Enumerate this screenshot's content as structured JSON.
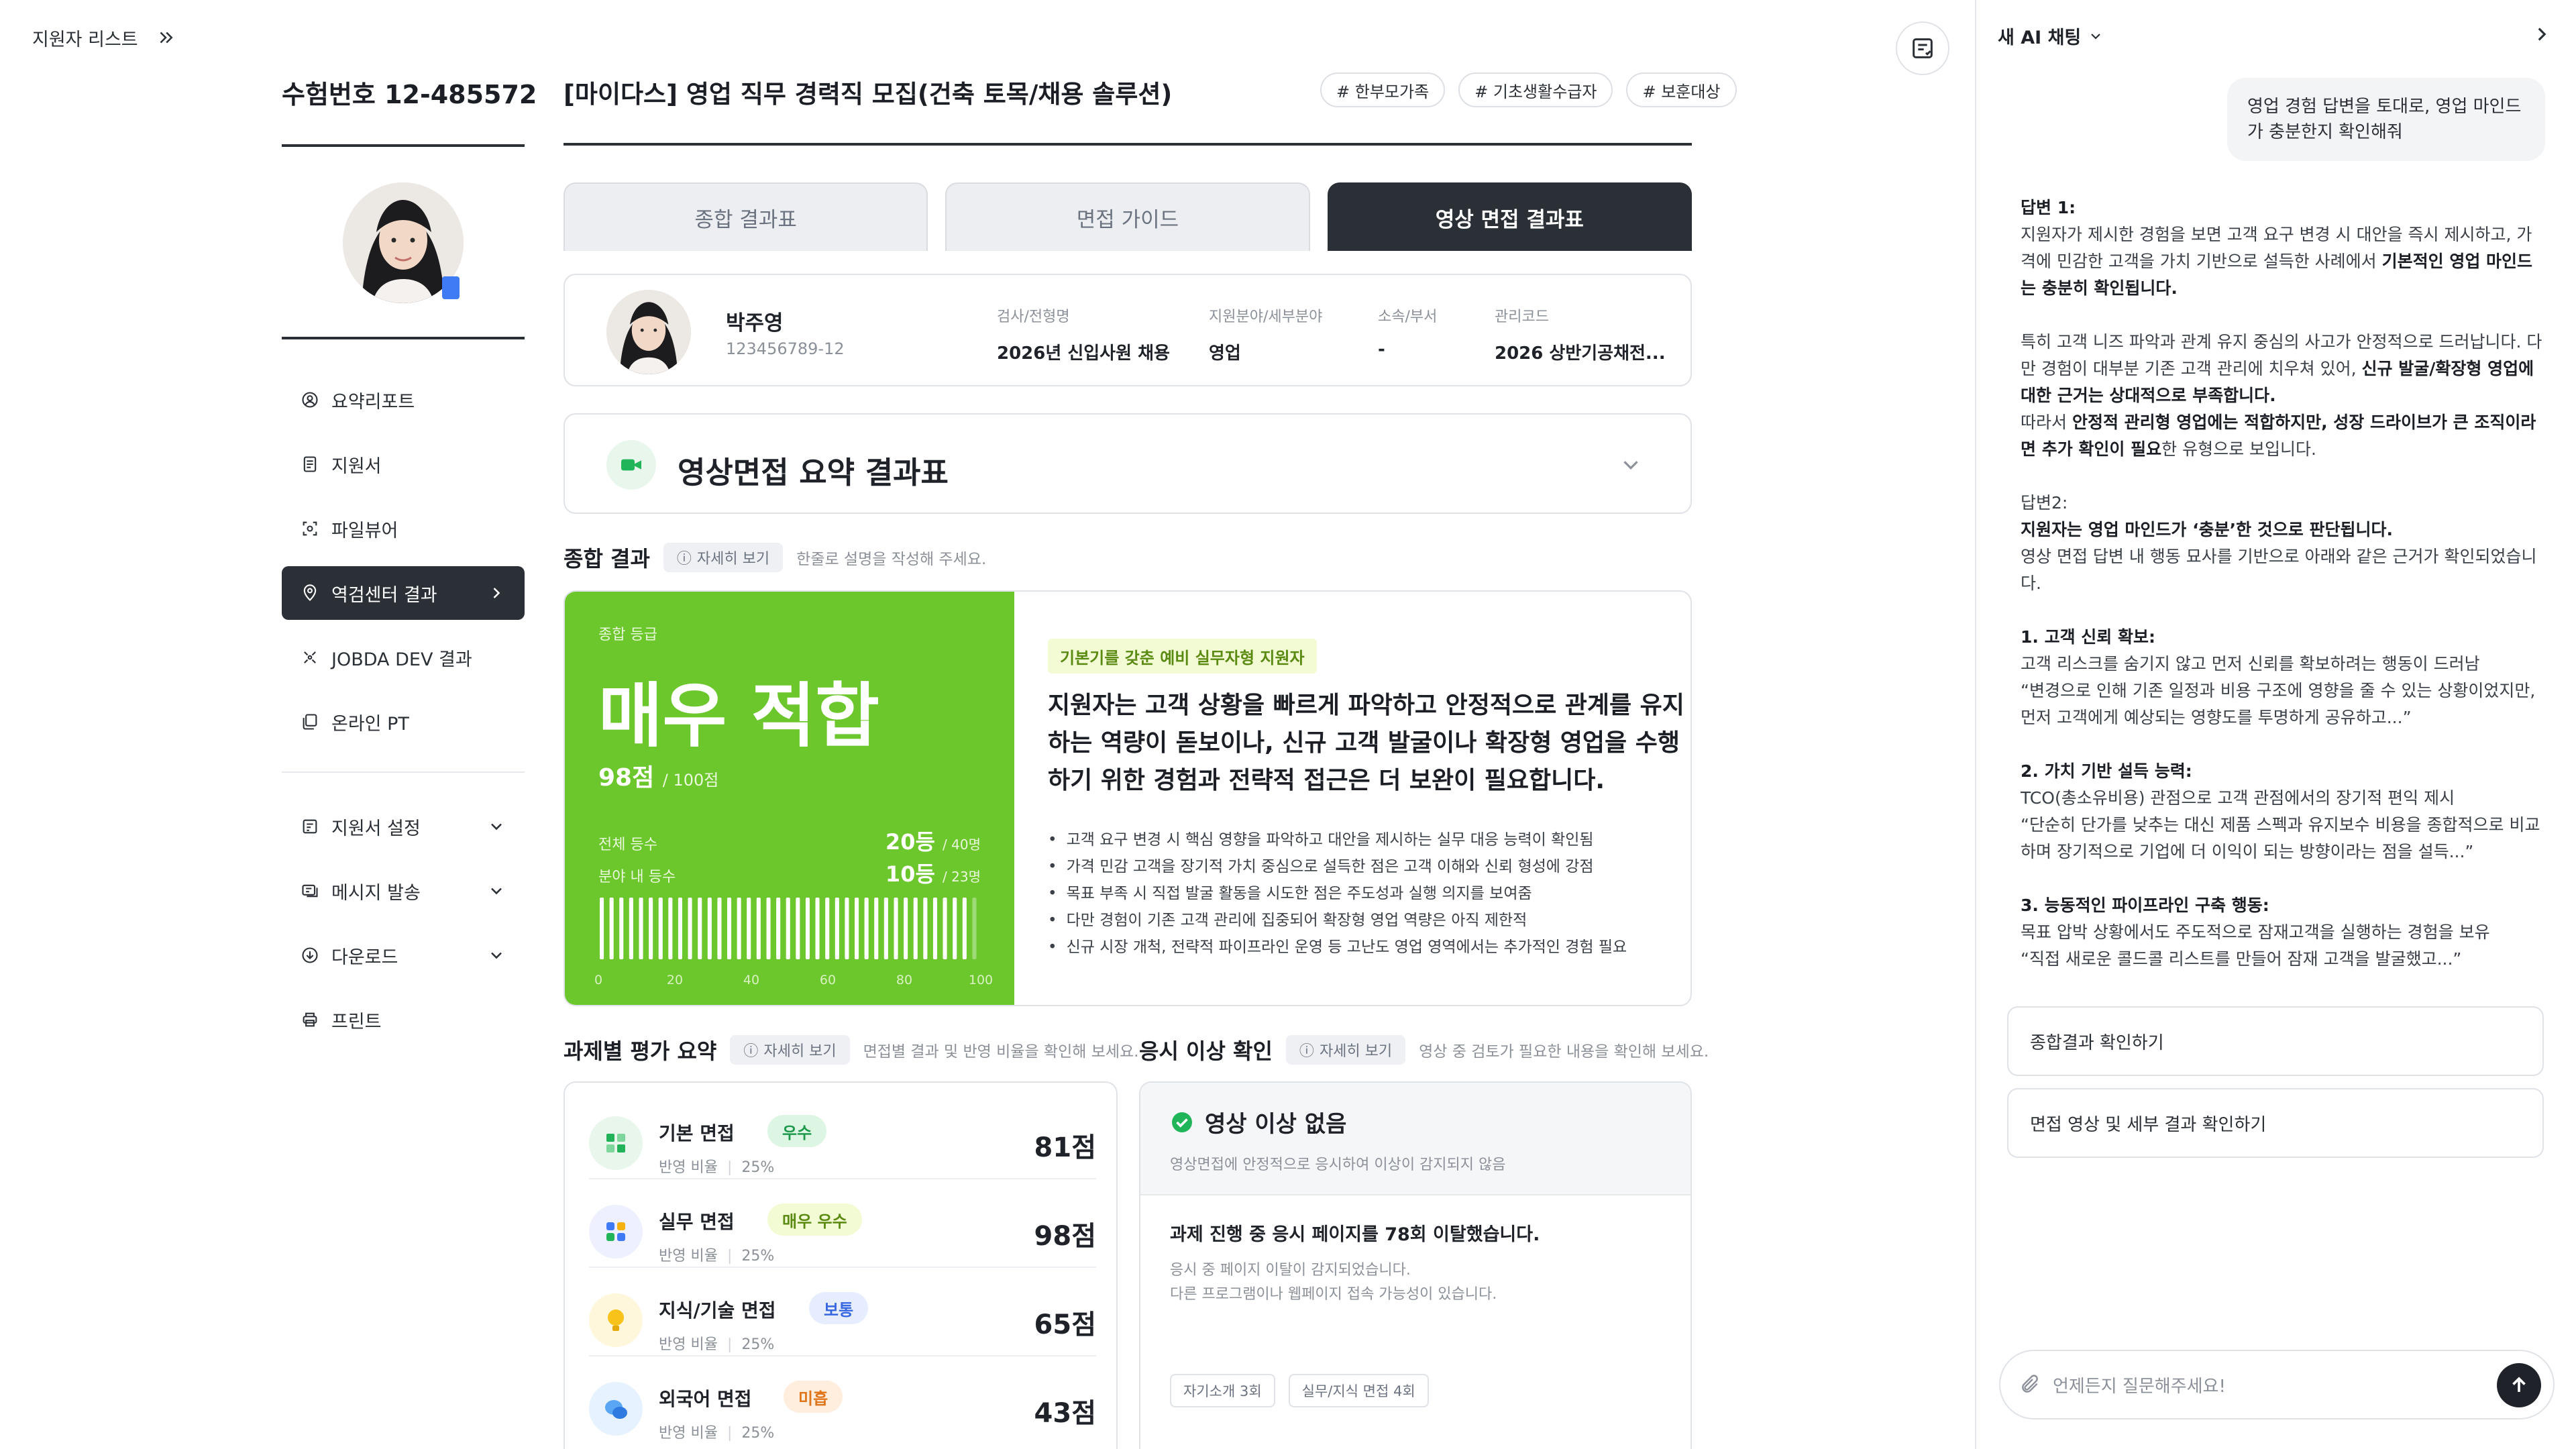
{
  "topnav": {
    "label": "지원자 리스트"
  },
  "exam": "수험번호 12-485572",
  "job_title": "[마이다스] 영업 직무 경력직 모집(건축 토목/채용 솔루션)",
  "tags": [
    "# 한부모가족",
    "# 기초생활수급자",
    "# 보훈대상"
  ],
  "sidebar": {
    "items": [
      {
        "label": "요약리포트",
        "icon": "user-circle-icon"
      },
      {
        "label": "지원서",
        "icon": "document-icon"
      },
      {
        "label": "파일뷰어",
        "icon": "scan-icon"
      },
      {
        "label": "역검센터 결과",
        "icon": "location-icon",
        "active": true
      },
      {
        "label": "JOBDA DEV 결과",
        "icon": "code-icon"
      },
      {
        "label": "온라인 PT",
        "icon": "slides-icon"
      }
    ],
    "items2": [
      {
        "label": "지원서 설정",
        "icon": "form-settings-icon"
      },
      {
        "label": "메시지 발송",
        "icon": "message-icon"
      },
      {
        "label": "다운로드",
        "icon": "download-icon"
      },
      {
        "label": "프린트",
        "icon": "printer-icon"
      }
    ]
  },
  "tabs": [
    "종합 결과표",
    "면접 가이드",
    "영상 면접 결과표"
  ],
  "profile": {
    "name": "박주영",
    "id": "123456789-12",
    "cols": [
      {
        "label": "검사/전형명",
        "value": "2026년 신입사원 채용"
      },
      {
        "label": "지원분야/세부분야",
        "value": "영업"
      },
      {
        "label": "소속/부서",
        "value": "-"
      },
      {
        "label": "관리코드",
        "value": "2026 상반기공채전..."
      }
    ]
  },
  "summary_title": "영상면접 요약 결과표",
  "overall": {
    "title": "종합 결과",
    "detail": "자세히 보기",
    "hint": "한줄로 설명을 작성해 주세요.",
    "grade_label": "종합 등급",
    "grade": "매우 적합",
    "score": "98점",
    "score_total": "/ 100점",
    "rank_all_label": "전체 등수",
    "rank_all": "20등",
    "rank_all_total": "/ 40명",
    "rank_field_label": "분야 내 등수",
    "rank_field": "10등",
    "rank_field_total": "/ 23명",
    "axis": [
      "0",
      "20",
      "40",
      "60",
      "80",
      "100"
    ],
    "badge": "기본기를 갖춘 예비 실무자형 지원자",
    "verdict": "지원자는 고객 상황을 빠르게 파악하고 안정적으로 관계를 유지하는 역량이 돋보이나, 신규 고객 발굴이나 확장형 영업을 수행하기 위한 경험과 전략적 접근은 더 보완이 필요합니다.",
    "bullets": [
      "고객 요구 변경 시 핵심 영향을 파악하고 대안을 제시하는 실무 대응 능력이 확인됨",
      "가격 민감 고객을 장기적 가치 중심으로 설득한 점은 고객 이해와 신뢰 형성에 강점",
      "목표 부족 시 직접 발굴 활동을 시도한 점은 주도성과 실행 의지를 보여줌",
      "다만 경험이 기존 고객 관리에 집중되어 확장형 영업 역량은 아직 제한적",
      "신규 시장 개척, 전략적 파이프라인 운영 등 고난도 영업 영역에서는 추가적인 경험 필요"
    ]
  },
  "tasks": {
    "title": "과제별 평가 요약",
    "detail": "자세히 보기",
    "hint": "면접별 결과 및 반영 비율을 확인해 보세요.",
    "weight_label": "반영 비율",
    "items": [
      {
        "name": "기본 면접",
        "badge": "우수",
        "weight": "25%",
        "score": "81점"
      },
      {
        "name": "실무 면접",
        "badge": "매우 우수",
        "weight": "25%",
        "score": "98점"
      },
      {
        "name": "지식/기술 면접",
        "badge": "보통",
        "weight": "25%",
        "score": "65점"
      },
      {
        "name": "외국어 면접",
        "badge": "미흡",
        "weight": "25%",
        "score": "43점"
      }
    ]
  },
  "anomaly": {
    "title": "응시 이상 확인",
    "detail": "자세히 보기",
    "hint": "영상 중 검토가 필요한 내용을 확인해 보세요.",
    "status": "영상 이상 없음",
    "status_sub": "영상면접에 안정적으로 응시하여 이상이 감지되지 않음",
    "headline": "과제 진행 중 응시 페이지를 78회 이탈했습니다.",
    "desc1": "응시 중 페이지 이탈이 감지되었습니다.",
    "desc2": "다른 프로그램이나 웹페이지 접속 가능성이 있습니다.",
    "chips": [
      "자기소개 3회",
      "실무/지식 면접 4회"
    ]
  },
  "ai": {
    "header": "새 AI 채팅",
    "question": "영업 경험 답변을 토대로, 영업 마인드가 충분한지 확인해줘",
    "suggestions": [
      "종합결과 확인하기",
      "면접 영상 및 세부 결과 확인하기"
    ],
    "input_placeholder": "언제든지 질문해주세요!"
  }
}
